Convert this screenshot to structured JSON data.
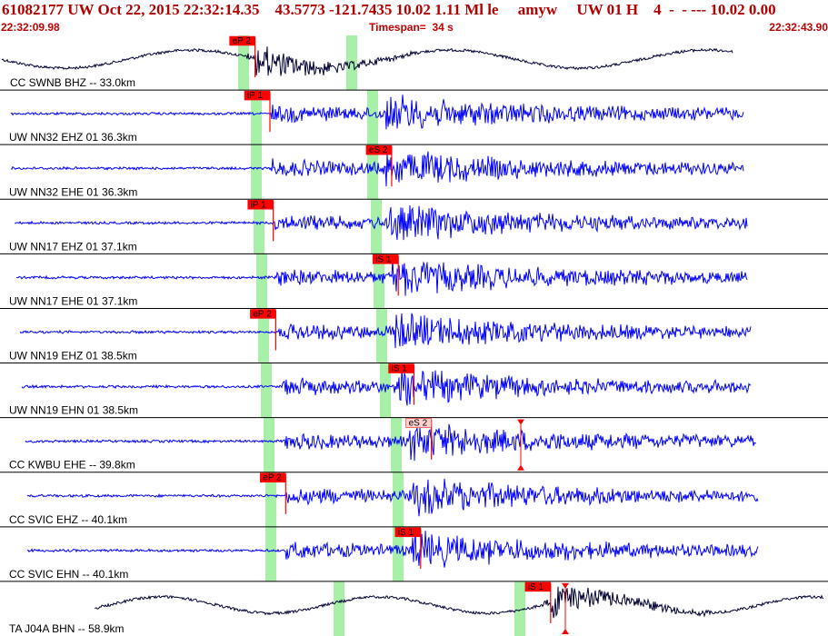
{
  "header": {
    "title": "61082177 UW Oct 22, 2015 22:32:14.35    43.5773 -121.7435 10.02 1.11 Ml le     amyw     UW 01 H    4  -  - --- 10.02 0.00",
    "time_start": "22:32:09.98",
    "timespan": "Timespan=  34 s",
    "time_end": "22:32:43.90"
  },
  "colors": {
    "trace_blue": "#0000ff",
    "trace_dark": "#000033",
    "pick_flag": "#ff0000",
    "pick_flag_light": "#ffd0d0",
    "window_green": "#a8f0a8",
    "divider": "#000000",
    "title_text": "#b00000"
  },
  "channels": [
    {
      "label": "CC SWNB BHZ -- 33.0km",
      "color": "dark",
      "amp": 1.0,
      "type": "long",
      "picks": [
        {
          "text": "eP 2",
          "t": 0.308,
          "style": "red"
        }
      ]
    },
    {
      "label": "UW NN32 EHZ 01 36.3km",
      "color": "blue",
      "amp": 1.0,
      "type": "quake",
      "picks": [
        {
          "text": "iP 1",
          "t": 0.326,
          "style": "red"
        }
      ]
    },
    {
      "label": "UW NN32 EHE 01 36.3km",
      "color": "blue",
      "amp": 1.0,
      "type": "quake",
      "picks": [
        {
          "text": "eS 2",
          "t": 0.473,
          "style": "red"
        }
      ]
    },
    {
      "label": "UW NN17 EHZ 01 37.1km",
      "color": "blue",
      "amp": 1.0,
      "type": "quake",
      "picks": [
        {
          "text": "iP 1",
          "t": 0.33,
          "style": "red"
        }
      ]
    },
    {
      "label": "UW NN17 EHE 01 37.1km",
      "color": "blue",
      "amp": 1.0,
      "type": "quake",
      "picks": [
        {
          "text": "iS 1",
          "t": 0.481,
          "style": "red"
        }
      ]
    },
    {
      "label": "UW NN19 EHZ 01 38.5km",
      "color": "blue",
      "amp": 1.0,
      "type": "quake",
      "picks": [
        {
          "text": "eP 2",
          "t": 0.333,
          "style": "red"
        }
      ]
    },
    {
      "label": "UW NN19 EHN 01 38.5km",
      "color": "blue",
      "amp": 1.0,
      "type": "quake",
      "picks": [
        {
          "text": "iS 1",
          "t": 0.5,
          "style": "red"
        }
      ]
    },
    {
      "label": "CC KWBU EHE -- 39.8km",
      "color": "blue",
      "amp": 1.0,
      "type": "quake",
      "picks": [
        {
          "text": "eS 2",
          "t": 0.521,
          "style": "light"
        }
      ]
    },
    {
      "label": "CC SVIC EHZ -- 40.1km",
      "color": "blue",
      "amp": 1.0,
      "type": "quake",
      "picks": [
        {
          "text": "eP 2",
          "t": 0.345,
          "style": "red"
        }
      ]
    },
    {
      "label": "CC SVIC EHN -- 40.1km",
      "color": "blue",
      "amp": 1.0,
      "type": "quake",
      "picks": [
        {
          "text": "iS 1",
          "t": 0.508,
          "style": "red"
        }
      ]
    },
    {
      "label": "TA J04A BHN -- 58.9km",
      "color": "dark",
      "amp": 1.0,
      "type": "long",
      "picks": [
        {
          "text": "iS 1",
          "t": 0.665,
          "style": "red"
        }
      ]
    }
  ]
}
